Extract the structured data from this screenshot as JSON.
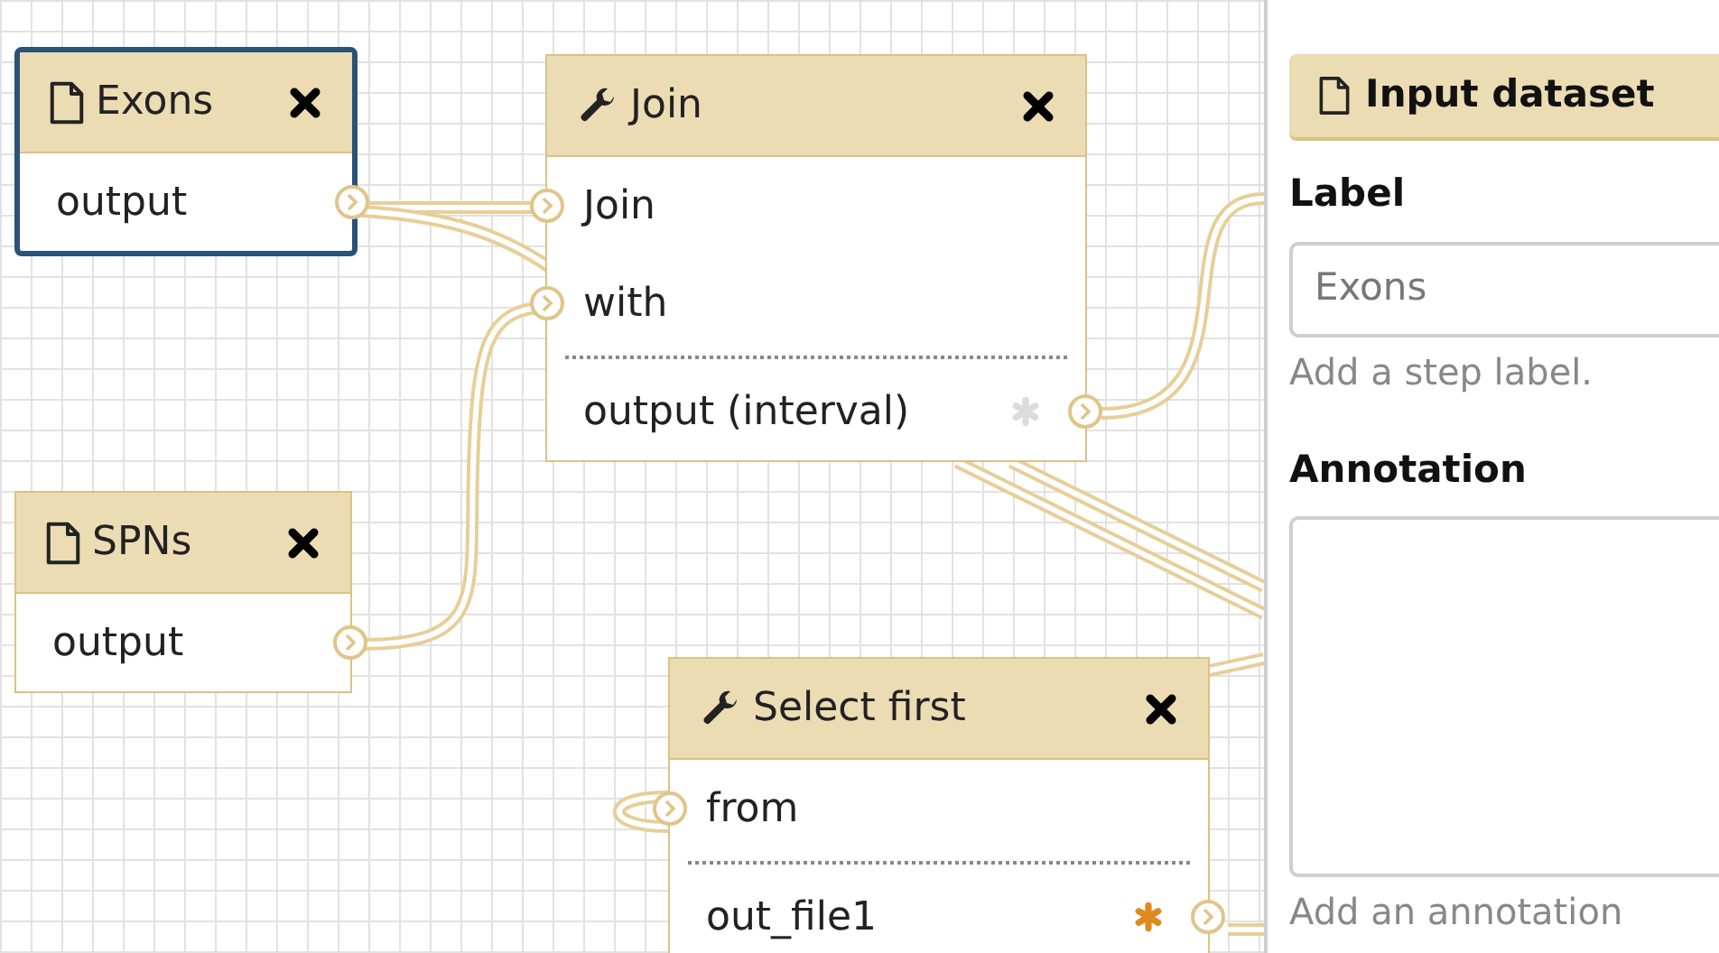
{
  "canvas": {
    "nodes": [
      {
        "kind": "input",
        "title": "Exons",
        "selected": true,
        "outputs": [
          {
            "label": "output"
          }
        ]
      },
      {
        "kind": "tool",
        "title": "Join",
        "selected": false,
        "inputs": [
          {
            "label": "Join"
          },
          {
            "label": "with"
          }
        ],
        "outputs": [
          {
            "label": "output (interval)",
            "workflow_output": false
          }
        ]
      },
      {
        "kind": "input",
        "title": "SPNs",
        "selected": false,
        "outputs": [
          {
            "label": "output"
          }
        ]
      },
      {
        "kind": "tool",
        "title": "Select first",
        "selected": false,
        "inputs": [
          {
            "label": "from"
          }
        ],
        "outputs": [
          {
            "label": "out_file1",
            "workflow_output": true
          }
        ]
      }
    ]
  },
  "panel": {
    "title": "Input dataset",
    "label": {
      "heading": "Label",
      "value": "Exons",
      "help": "Add a step label."
    },
    "annotation": {
      "heading": "Annotation",
      "help": "Add an annotation"
    }
  }
}
